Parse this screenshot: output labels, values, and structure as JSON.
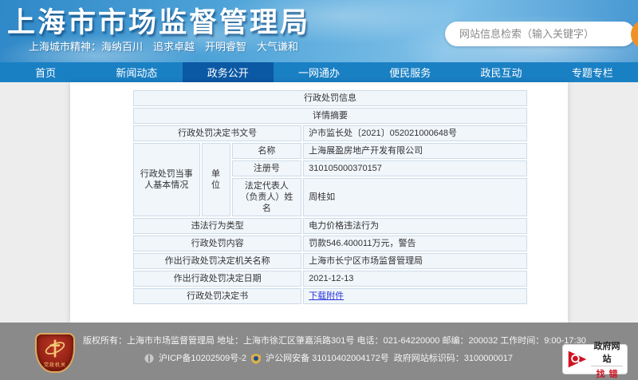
{
  "header": {
    "site_title": "上海市市场监督管理局",
    "slogan": "上海城市精神：海纳百川　追求卓越　开明睿智　大气谦和",
    "search_placeholder": "网站信息检索（输入关键字）",
    "search_value": ""
  },
  "nav": {
    "items": [
      {
        "label": "首页",
        "active": false
      },
      {
        "label": "新闻动态",
        "active": false
      },
      {
        "label": "政务公开",
        "active": true
      },
      {
        "label": "一网通办",
        "active": false
      },
      {
        "label": "便民服务",
        "active": false
      },
      {
        "label": "政民互动",
        "active": false
      },
      {
        "label": "专题专栏",
        "active": false
      }
    ]
  },
  "penalty": {
    "section_title": "行政处罚信息",
    "section_subtitle": "详情摘要",
    "doc_number_label": "行政处罚决定书文号",
    "doc_number": "沪市监长处〔2021〕052021000648号",
    "party_label": "行政处罚当事人基本情况",
    "unit_label": "单位",
    "name_label": "名称",
    "name": "上海展盈房地产开发有限公司",
    "reg_no_label": "注册号",
    "reg_no": "310105000370157",
    "legal_rep_label": "法定代表人（负责人）姓名",
    "legal_rep": "周桂如",
    "violation_type_label": "违法行为类型",
    "violation_type": "电力价格违法行为",
    "penalty_content_label": "行政处罚内容",
    "penalty_content": "罚款546.400011万元，警告",
    "authority_label": "作出行政处罚决定机关名称",
    "authority": "上海市长宁区市场监督管理局",
    "decision_date_label": "作出行政处罚决定日期",
    "decision_date": "2021-12-13",
    "decision_doc_label": "行政处罚决定书",
    "attachment_link": "下载附件"
  },
  "footer": {
    "line1": "版权所有：上海市市场监督管理局 地址：上海市徐汇区肇嘉浜路301号 电话：021-64220000 邮编：200032 工作时间：9:00-17:30",
    "icp": "沪ICP备10202509号-2",
    "police": "沪公网安备 31010402004172号",
    "site_code": "政府网站标识码：3100000017",
    "shield_badge_text": "党政机关",
    "error_badge_line1": "政府网站",
    "error_badge_line2": "找错"
  },
  "colors": {
    "nav_bg": "#1a80c4",
    "nav_active": "#0b58a4",
    "table_cell_bg": "#f1f6fb",
    "table_border": "#ccdce8",
    "link": "#2b36d9",
    "search_button": "#ef9126",
    "footer_bg": "#8a8a8a",
    "error_badge_red": "#cf1322"
  }
}
